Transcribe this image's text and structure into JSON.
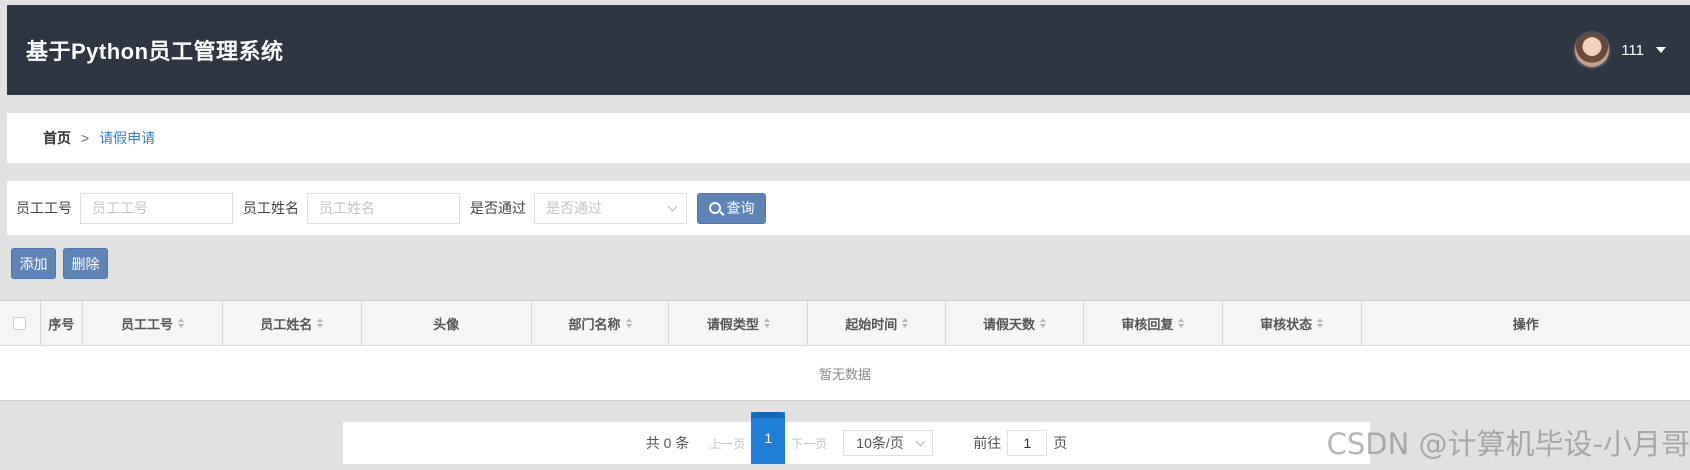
{
  "header": {
    "title": "基于Python员工管理系统",
    "user_name": "111"
  },
  "breadcrumb": {
    "home": "首页",
    "separator": ">",
    "current": "请假申请"
  },
  "search": {
    "employee_no_label": "员工工号",
    "employee_no_placeholder": "员工工号",
    "employee_name_label": "员工姓名",
    "employee_name_placeholder": "员工姓名",
    "approved_label": "是否通过",
    "approved_placeholder": "是否通过",
    "query_button": "查询"
  },
  "actions": {
    "add_button": "添加",
    "delete_button": "删除"
  },
  "table": {
    "columns": [
      "序号",
      "员工工号",
      "员工姓名",
      "头像",
      "部门名称",
      "请假类型",
      "起始时间",
      "请假天数",
      "审核回复",
      "审核状态",
      "操作"
    ],
    "empty_text": "暂无数据"
  },
  "pagination": {
    "total_text": "共 0 条",
    "prev": "上一页",
    "current_page": "1",
    "next": "下一页",
    "page_size": "10条/页",
    "goto_label": "前往",
    "goto_value": "1",
    "page_suffix": "页"
  },
  "watermark": "CSDN @计算机毕设-小月哥"
}
